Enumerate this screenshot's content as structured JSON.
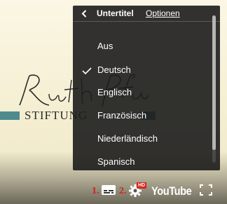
{
  "menu": {
    "title": "Untertitel",
    "options_label": "Optionen",
    "items": [
      {
        "label": "Aus",
        "selected": false
      },
      {
        "label": "Deutsch",
        "selected": true
      },
      {
        "label": "Englisch",
        "selected": false
      },
      {
        "label": "Französisch",
        "selected": false
      },
      {
        "label": "Niederländisch",
        "selected": false
      },
      {
        "label": "Spanisch",
        "selected": false
      }
    ]
  },
  "video": {
    "logo_wordmark": "STIFTUNG",
    "logo_signature_text": "Ruth Pfau",
    "logo_color": "#4f8a8c"
  },
  "controls": {
    "annotation_1": "1.",
    "annotation_2": "2.",
    "hd_badge": "HD",
    "brand": "YouTube",
    "icons": [
      "subtitles-icon",
      "gear-icon",
      "fullscreen-icon"
    ]
  },
  "colors": {
    "menu_bg": "#1c1c1c",
    "annotation": "#d42020",
    "hd_badge": "#d4281f"
  }
}
